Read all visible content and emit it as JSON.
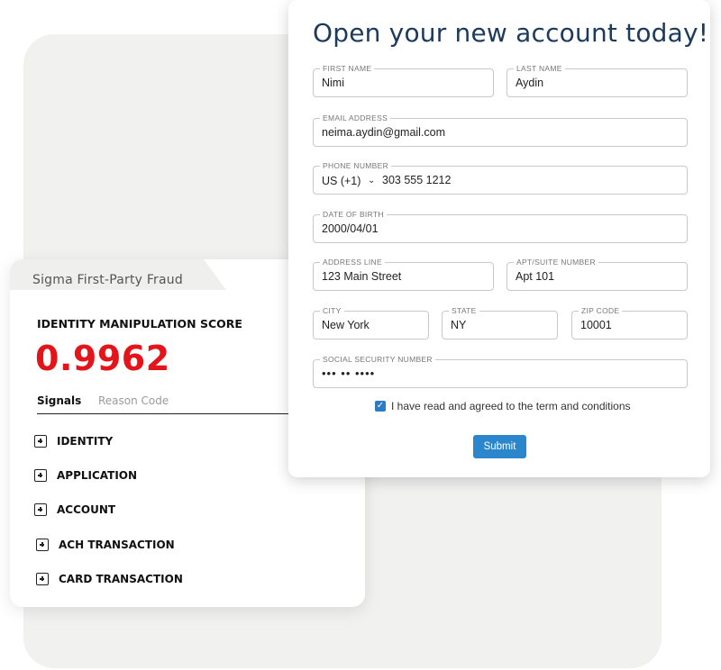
{
  "sigma": {
    "tab_title": "Sigma First-Party Fraud",
    "score_label": "IDENTITY MANIPULATION SCORE",
    "score_value": "0.9962",
    "tabs": {
      "active": "Signals",
      "inactive": "Reason Code"
    },
    "signals": [
      "IDENTITY",
      "APPLICATION",
      "ACCOUNT",
      "ACH TRANSACTION",
      "CARD TRANSACTION"
    ]
  },
  "form": {
    "title": "Open your new account today!",
    "first_name": {
      "label": "FIRST NAME",
      "value": "Nimi"
    },
    "last_name": {
      "label": "LAST NAME",
      "value": "Aydin"
    },
    "email": {
      "label": "EMAIL ADDRESS",
      "value": "neima.aydin@gmail.com"
    },
    "phone": {
      "label": "PHONE NUMBER",
      "country": "US (+1)",
      "value": "303 555 1212"
    },
    "dob": {
      "label": "DATE OF BIRTH",
      "value": "2000/04/01"
    },
    "address": {
      "label": "ADDRESS LINE",
      "value": "123 Main Street"
    },
    "apt": {
      "label": "APT/SUITE NUMBER",
      "value": "Apt 101"
    },
    "city": {
      "label": "CITY",
      "value": "New York"
    },
    "state": {
      "label": "STATE",
      "value": "NY"
    },
    "zip": {
      "label": "ZIP CODE",
      "value": "10001"
    },
    "ssn": {
      "label": "SOCIAL SECURITY NUMBER",
      "value": "••• •• ••••"
    },
    "agree_text": "I have read and agreed to the term and conditions",
    "submit_label": "Submit"
  },
  "colors": {
    "score": "#e3151b",
    "title": "#1c3a5c",
    "accent": "#2b86cc"
  },
  "icons": {
    "expand": "plus-square-icon",
    "checkbox": "checkmark-icon",
    "dropdown": "chevron-down-icon"
  }
}
